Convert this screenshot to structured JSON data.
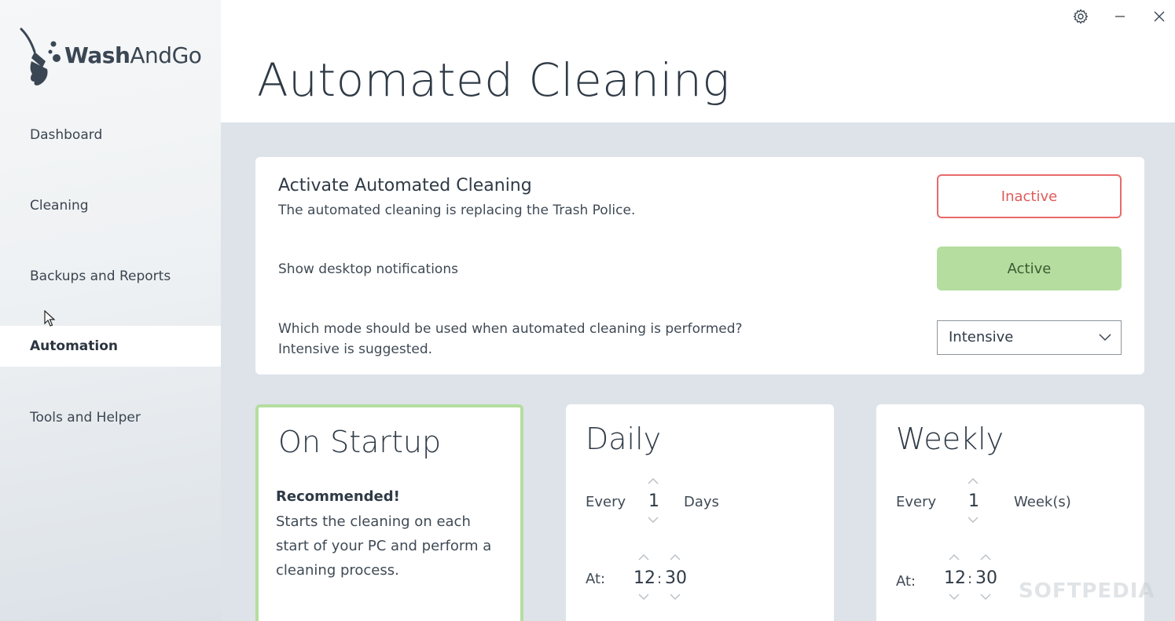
{
  "app": {
    "logo_text_bold": "Wash",
    "logo_text_rest": "AndGo"
  },
  "sidebar": {
    "items": [
      {
        "label": "Dashboard",
        "active": false
      },
      {
        "label": "Cleaning",
        "active": false
      },
      {
        "label": "Backups and Reports",
        "active": false
      },
      {
        "label": "Automation",
        "active": true
      },
      {
        "label": "Tools and Helper",
        "active": false
      }
    ]
  },
  "header": {
    "title": "Automated Cleaning"
  },
  "settings": {
    "activate_title": "Activate Automated Cleaning",
    "activate_sub": "The automated cleaning is replacing the Trash Police.",
    "activate_state": "Inactive",
    "notifications_label": "Show desktop notifications",
    "notifications_state": "Active",
    "mode_question": "Which mode should be used when automated cleaning is performed?",
    "mode_hint": "Intensive is suggested.",
    "mode_value": "Intensive"
  },
  "startup": {
    "title": "On Startup",
    "recommended": "Recommended!",
    "description": "Starts the cleaning on each start of your PC and perform a cleaning process."
  },
  "daily": {
    "title": "Daily",
    "every_label": "Every",
    "every_value": "1",
    "unit": "Days",
    "at_label": "At:",
    "hour": "12",
    "sep": ":",
    "minute": "30"
  },
  "weekly": {
    "title": "Weekly",
    "every_label": "Every",
    "every_value": "1",
    "unit": "Week(s)",
    "at_label": "At:",
    "hour": "12",
    "sep": ":",
    "minute": "30"
  },
  "watermark": "SOFTPEDIA",
  "colors": {
    "accent_green": "#b4dd9f",
    "inactive_red": "#e86a6a"
  }
}
